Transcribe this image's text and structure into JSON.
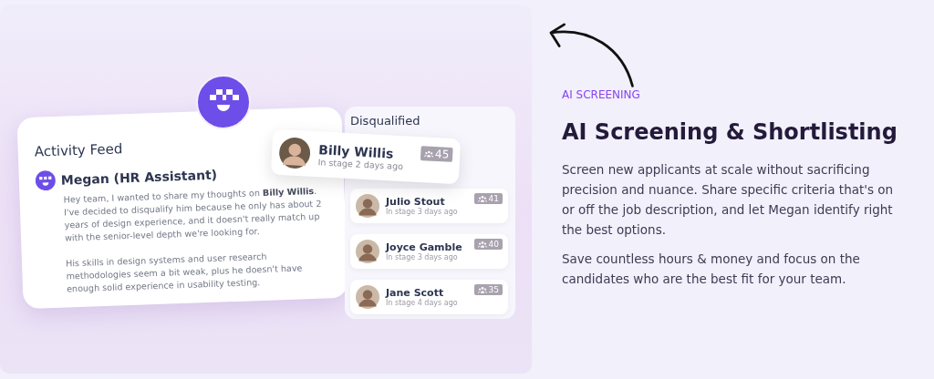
{
  "illustration": {
    "activity_feed": {
      "title": "Activity Feed",
      "author": "Megan (HR Assistant)",
      "paragraphs": [
        "Hey team, I wanted to share my thoughts on **Billy Willis**. I've decided to disqualify him because he only has about 2 years of design experience, and it doesn't really match up with the senior-level depth we're looking for.",
        "His skills in design systems and user research methodologies seem a bit weak, plus he doesn't have enough solid experience in usability testing."
      ]
    },
    "highlighted_candidate": {
      "name": "Billy Willis",
      "stage": "In stage 2 days ago",
      "score": "45"
    },
    "disqualified": {
      "title": "Disqualified",
      "candidates": [
        {
          "name": "Julio Stout",
          "stage": "In stage 3 days ago",
          "score": "41"
        },
        {
          "name": "Joyce Gamble",
          "stage": "In stage 3 days ago",
          "score": "40"
        },
        {
          "name": "Jane Scott",
          "stage": "In stage 4 days ago",
          "score": "35"
        }
      ]
    }
  },
  "section": {
    "eyebrow": "AI SCREENING",
    "title": "AI Screening & Shortlisting",
    "paragraphs": [
      "Screen new applicants at scale without sacrificing precision and nuance. Share specific criteria that's on or off the job description, and let Megan identify right the best options.",
      "Save countless hours & money and focus on the candidates who are the best fit for your team."
    ]
  }
}
